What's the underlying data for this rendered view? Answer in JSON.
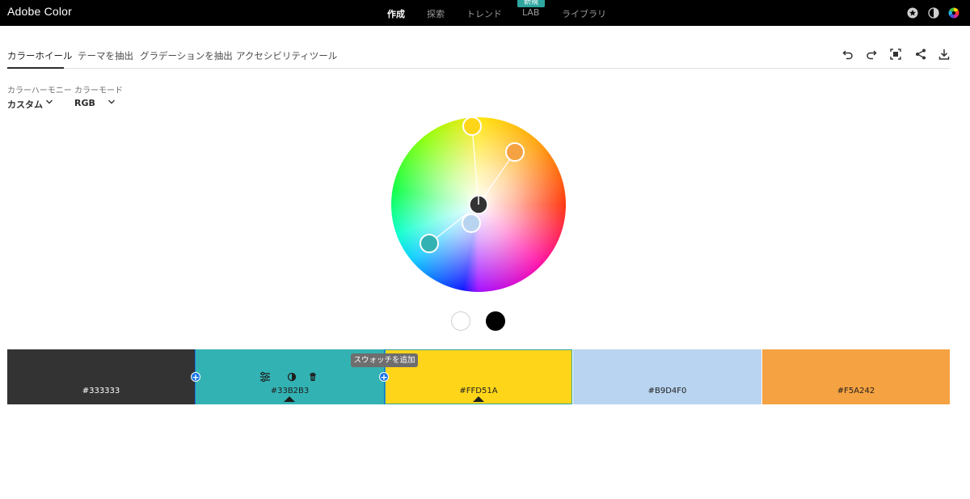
{
  "app": {
    "title": "Adobe Color"
  },
  "topnav": {
    "items": [
      {
        "label": "作成",
        "active": true
      },
      {
        "label": "探索",
        "active": false
      },
      {
        "label": "トレンド",
        "active": false
      },
      {
        "label": "LAB",
        "active": false
      },
      {
        "label": "ライブラリ",
        "active": false
      }
    ],
    "badge": "新規",
    "icons": [
      "star-icon",
      "contrast-icon",
      "color-wheel-logo-icon"
    ]
  },
  "tabs": [
    {
      "label": "カラーホイール",
      "active": true
    },
    {
      "label": "テーマを抽出",
      "active": false
    },
    {
      "label": "グラデーションを抽出",
      "active": false
    },
    {
      "label": "アクセシビリティツール",
      "active": false
    }
  ],
  "toolbar_icons": [
    "undo-icon",
    "redo-icon",
    "fullscreen-icon",
    "share-icon",
    "download-icon"
  ],
  "harmony": {
    "label": "カラーハーモニー",
    "value": "カスタム"
  },
  "color_mode": {
    "label": "カラーモード",
    "value": "RGB"
  },
  "swatches": [
    {
      "hex": "#333333",
      "color": "#333333",
      "text_color": "#ffffff"
    },
    {
      "hex": "#33B2B3",
      "color": "#33B2B3",
      "text_color": "#1e1e1e"
    },
    {
      "hex": "#FFD51A",
      "color": "#FFD51A",
      "text_color": "#1e1e1e"
    },
    {
      "hex": "#B9D4F0",
      "color": "#B9D4F0",
      "text_color": "#1e1e1e"
    },
    {
      "hex": "#F5A242",
      "color": "#F5A242",
      "text_color": "#1e1e1e"
    }
  ],
  "tooltip": "スウォッチを追加",
  "accent": "#1473e6"
}
